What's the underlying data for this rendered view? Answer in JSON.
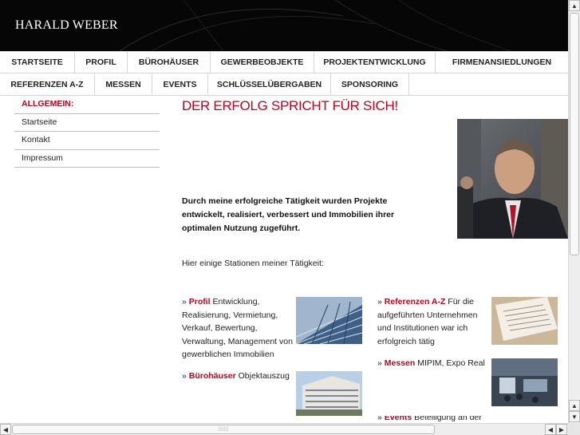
{
  "header": {
    "title": "HARALD WEBER"
  },
  "nav_primary": [
    {
      "label": "STARTSEITE"
    },
    {
      "label": "PROFIL"
    },
    {
      "label": "BÜROHÄUSER"
    },
    {
      "label": "GEWERBEOBJEKTE"
    },
    {
      "label": "PROJEKTENTWICKLUNG"
    },
    {
      "label": "FIRMENANSIEDLUNGEN"
    }
  ],
  "nav_secondary": [
    {
      "label": "REFERENZEN A-Z"
    },
    {
      "label": "MESSEN"
    },
    {
      "label": "EVENTS"
    },
    {
      "label": "SCHLÜSSELÜBERGABEN"
    },
    {
      "label": "SPONSORING"
    }
  ],
  "sidebar": {
    "heading": "ALLGEMEIN:",
    "items": [
      {
        "label": "Startseite"
      },
      {
        "label": "Kontakt"
      },
      {
        "label": "Impressum"
      }
    ]
  },
  "main": {
    "title": "DER ERFOLG SPRICHT FÜR SICH!",
    "intro": "Durch meine erfolgreiche Tätigkeit wurden Projekte entwickelt, realisiert, verbessert und Immobilien ihrer optimalen Nutzung zugeführt.",
    "stations_intro": "Hier einige Stationen meiner Tätigkeit:",
    "items": [
      {
        "prefix": "» ",
        "link": "Profil",
        "text": " Entwicklung, Realisierung, Vermietung, Verkauf, Bewertung, Verwaltung, Management von gewerblichen Immobilien"
      },
      {
        "prefix": "» ",
        "link": "Bürohäuser",
        "text": " Objektauszug"
      },
      {
        "prefix": "» ",
        "link": "Referenzen A-Z",
        "text": " Für die aufgeführten Unternehmen und Institutionen war ich erfolgreich tätig"
      },
      {
        "prefix": "» ",
        "link": "Messen",
        "text": " MIPIM, Expo Real"
      },
      {
        "prefix": "» ",
        "link": "Events",
        "text": " Beteiligung an der"
      }
    ]
  },
  "colors": {
    "accent": "#c4001a",
    "header_bg": "#060606",
    "border": "#d6d6d6"
  },
  "icons": {
    "scroll_up": "▲",
    "scroll_down": "▼",
    "scroll_left": "◀",
    "scroll_right": "▶",
    "grip": "⁞⁞⁞⁞⁞⁞⁞"
  }
}
